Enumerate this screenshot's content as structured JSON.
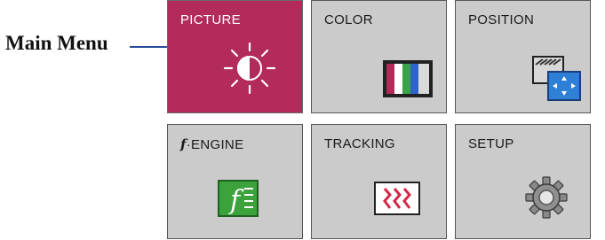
{
  "callout": {
    "label": "Main Menu"
  },
  "menu": {
    "selected": "PICTURE",
    "tiles": [
      {
        "label": "PICTURE",
        "icon": "brightness-sun-icon"
      },
      {
        "label": "COLOR",
        "icon": "color-bars-icon"
      },
      {
        "label": "POSITION",
        "icon": "position-move-icon"
      },
      {
        "label_prefix": "f",
        "label": "·ENGINE",
        "icon": "f-engine-icon",
        "icon_glyph": "f"
      },
      {
        "label": "TRACKING",
        "icon": "tracking-wave-icon"
      },
      {
        "label": "SETUP",
        "icon": "gear-icon"
      }
    ]
  },
  "colors": {
    "selected_tile": "#b32a5c",
    "tile": "#cbcbcb",
    "callout_line": "#2a4a9a"
  }
}
